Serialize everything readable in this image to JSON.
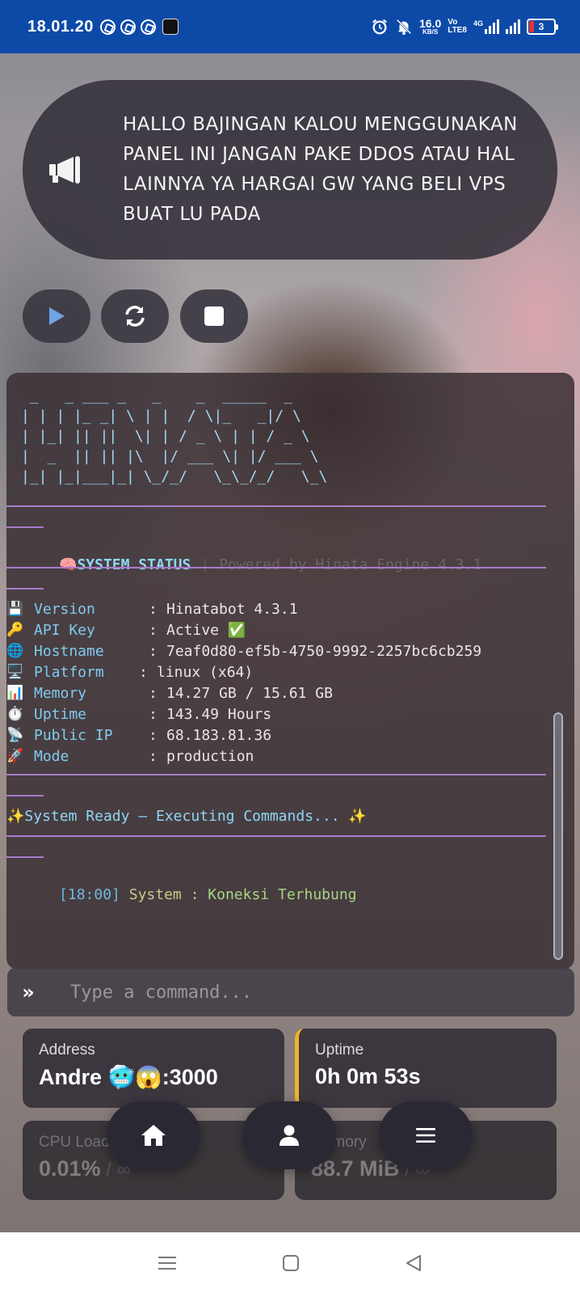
{
  "statusbar": {
    "time": "18.01.20",
    "speed_value": "16.0",
    "speed_unit": "KB/S",
    "volte_top": "Vo",
    "volte_bottom": "LTE8",
    "network": "4G",
    "battery_level": "3"
  },
  "announcement": {
    "icon": "megaphone-icon",
    "text": "HALLO BAJINGAN KALOU MENGGUNAKAN PANEL INI JANGAN PAKE DDOS ATAU HAL LAINNYA YA HARGAI GW YANG BELI VPS BUAT LU PADA"
  },
  "controls": {
    "start_icon": "play-icon",
    "restart_icon": "refresh-icon",
    "stop_icon": "stop-icon"
  },
  "terminal": {
    "ascii_art": " _   _ ___ _   _    _  _____  _    \n| | | |_ _| \\ | |  / \\|_   _|/ \\   \n| |_| || ||  \\| | / _ \\ | | / _ \\  \n|  _  || || |\\  |/ ___ \\| |/ ___ \\ \n|_| |_|___|_| \\_/_/   \\_\\_/_/   \\_\\",
    "status_emoji": "🧠",
    "status_title": "SYSTEM STATUS",
    "status_separator": "|",
    "powered_by": "Powered by Hinata Engine 4.3.1",
    "info": [
      {
        "emoji": "💾",
        "key": "Version",
        "colon": ":",
        "value": "Hinatabot 4.3.1"
      },
      {
        "emoji": "🔑",
        "key": "API Key",
        "colon": ":",
        "value": "Active ✅"
      },
      {
        "emoji": "🌐",
        "key": "Hostname",
        "colon": ":",
        "value": "7eaf0d80-ef5b-4750-9992-2257bc6cb259"
      },
      {
        "emoji": "🖥️",
        "key": "Platform",
        "colon": ":",
        "value": "linux (x64)"
      },
      {
        "emoji": "📊",
        "key": "Memory",
        "colon": ":",
        "value": "14.27 GB / 15.61 GB"
      },
      {
        "emoji": "⏱️",
        "key": "Uptime",
        "colon": ":",
        "value": "143.49 Hours"
      },
      {
        "emoji": "📡",
        "key": "Public IP",
        "colon": ":",
        "value": "68.183.81.36"
      },
      {
        "emoji": "🚀",
        "key": "Mode",
        "colon": ":",
        "value": "production"
      }
    ],
    "ready_text": "✨System Ready — Executing Commands... ✨",
    "log": {
      "time": "[18:00]",
      "source": "System :",
      "message": "Koneksi Terhubung"
    }
  },
  "command": {
    "prompt": "»",
    "placeholder": "Type a command..."
  },
  "stats": {
    "address_label": "Address",
    "address_value": "Andre 🥶😱:3000",
    "uptime_label": "Uptime",
    "uptime_value": "0h 0m 53s",
    "cpu_label": "CPU Load",
    "cpu_value": "0.01%",
    "cpu_max": " / ∞",
    "memory_label": "Memory",
    "memory_value": "88.7 MiB",
    "memory_max": " / ∞",
    "accent_color": "#f0b429"
  },
  "bottom_nav": {
    "home_icon": "home-icon",
    "user_icon": "user-icon",
    "menu_icon": "menu-icon"
  },
  "system_nav": {
    "recents_icon": "recents-icon",
    "home_icon": "home-square-icon",
    "back_icon": "back-icon"
  }
}
